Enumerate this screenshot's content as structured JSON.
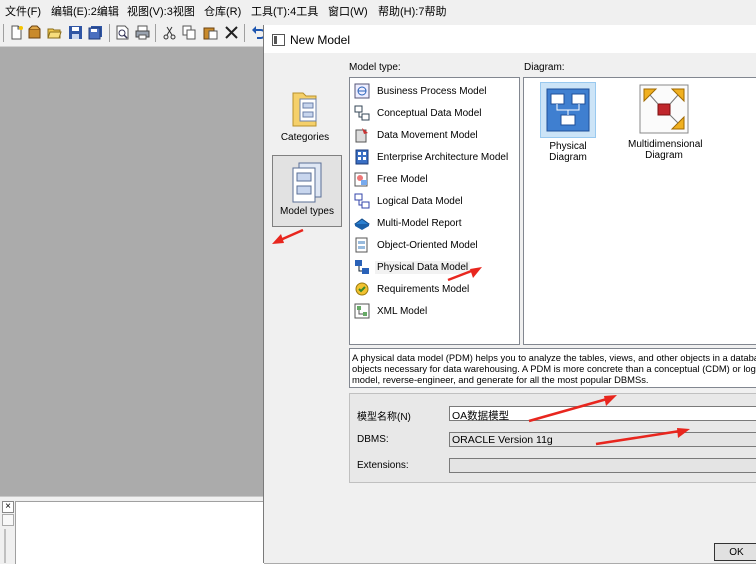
{
  "menu": {
    "items": [
      "文件(F)",
      "编辑(E):2编辑",
      "视图(V):3视图",
      "仓库(R)",
      "工具(T):4工具",
      "窗口(W)",
      "帮助(H):7帮助"
    ]
  },
  "toolbar": {
    "icons": [
      "new-icon",
      "open-package-icon",
      "open-folder-icon",
      "save-icon",
      "save-all-icon",
      "print-preview-icon",
      "print-icon",
      "cut-icon",
      "copy-icon",
      "paste-icon",
      "delete-icon",
      "undo-icon"
    ]
  },
  "output_pane": {
    "close_glyph": "×"
  },
  "dialog": {
    "title": "New Model",
    "categories": [
      {
        "label": "Categories",
        "selected": false
      },
      {
        "label": "Model types",
        "selected": true
      }
    ],
    "model_type_label": "Model type:",
    "diagram_label": "Diagram:",
    "model_types": [
      "Business Process Model",
      "Conceptual Data Model",
      "Data Movement Model",
      "Enterprise Architecture Model",
      "Free Model",
      "Logical Data Model",
      "Multi-Model Report",
      "Object-Oriented Model",
      "Physical Data Model",
      "Requirements Model",
      "XML Model"
    ],
    "selected_model_type": "Physical Data Model",
    "diagrams": [
      {
        "label": "Physical Diagram",
        "selected": true
      },
      {
        "label": "Multidimensional Diagram",
        "selected": false
      }
    ],
    "description": [
      "A physical data model (PDM) helps you to analyze the tables, views, and other objects in a databas",
      "objects necessary for data warehousing. A PDM is more concrete than a conceptual (CDM) or logi",
      "model, reverse-engineer, and generate for all the most popular DBMSs."
    ],
    "fields": {
      "model_name_label": "模型名称(N)",
      "model_name_value": "OA数据模型",
      "dbms_label": "DBMS:",
      "dbms_value": "ORACLE Version 11g",
      "extensions_label": "Extensions:",
      "extensions_value": ""
    },
    "ok_label": "OK"
  },
  "colors": {
    "annotation_arrow": "#e8261e",
    "selection": "#cce4f7"
  }
}
